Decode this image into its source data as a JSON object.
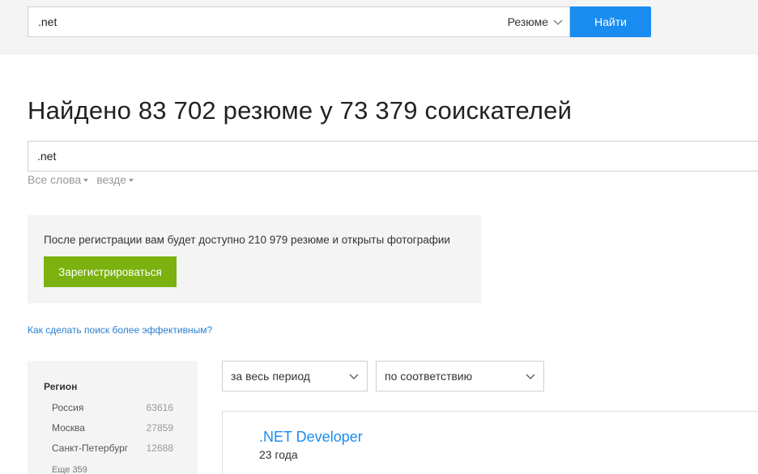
{
  "top_search": {
    "value": ".net",
    "type_label": "Резюме",
    "find_label": "Найти"
  },
  "heading": "Найдено 83 702 резюме у 73 379 соискателей",
  "main_search": {
    "value": ".net",
    "words_label": "Все слова",
    "where_label": "везде"
  },
  "registration": {
    "text": "После регистрации вам будет доступно 210 979 резюме и открыты фотографии",
    "button_label": "Зарегистрироваться"
  },
  "help_link": "Как сделать поиск более эффективным?",
  "sidebar": {
    "title": "Регион",
    "regions": [
      {
        "name": "Россия",
        "count": "63616"
      },
      {
        "name": "Москва",
        "count": "27859"
      },
      {
        "name": "Санкт-Петербург",
        "count": "12688"
      }
    ],
    "more_label": "Еще 359"
  },
  "filters": {
    "period": "за весь период",
    "sort": "по соответствию"
  },
  "result": {
    "title": ".NET Developer",
    "age": "23 года"
  },
  "colors": {
    "accent_blue": "#1a8cf0",
    "register_green": "#7bb20f",
    "panel_gray": "#f4f4f4"
  }
}
